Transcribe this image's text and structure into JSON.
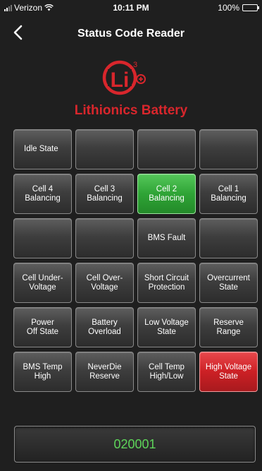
{
  "status_bar": {
    "carrier": "Verizon",
    "time": "10:11 PM",
    "battery": "100%"
  },
  "nav": {
    "title": "Status Code Reader"
  },
  "brand": {
    "name": "Lithionics Battery",
    "color": "#d8262c"
  },
  "tiles": [
    [
      "Idle State",
      "",
      "",
      ""
    ],
    [
      "Cell 4\nBalancing",
      "Cell 3\nBalancing",
      "Cell 2\nBalancing",
      "Cell 1\nBalancing"
    ],
    [
      "",
      "",
      "BMS Fault",
      ""
    ],
    [
      "Cell Under-\nVoltage",
      "Cell Over-\nVoltage",
      "Short Circuit\nProtection",
      "Overcurrent\nState"
    ],
    [
      "Power\nOff State",
      "Battery\nOverload",
      "Low Voltage\nState",
      "Reserve\nRange"
    ],
    [
      "BMS Temp\nHigh",
      "NeverDie\nReserve",
      "Cell Temp\nHigh/Low",
      "High Voltage\nState"
    ]
  ],
  "active_tiles": {
    "green": "Cell 2 Balancing",
    "red": "High Voltage State"
  },
  "status_code": "020001",
  "colors": {
    "active_green": "#2fa436",
    "alert_red": "#cc2025",
    "code_text": "#5ed45a"
  }
}
